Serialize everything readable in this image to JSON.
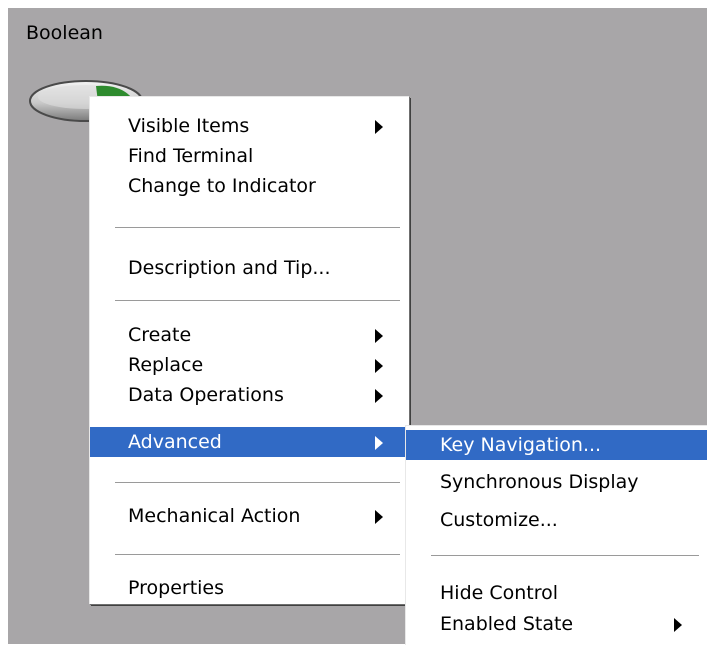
{
  "control": {
    "label": "Boolean",
    "switch_icon": "boolean-switch-icon"
  },
  "context_menu": {
    "items": [
      {
        "label": "Visible Items",
        "submenu": true
      },
      {
        "label": "Find Terminal",
        "submenu": false
      },
      {
        "label": "Change to Indicator",
        "submenu": false
      },
      {
        "label": "Description and Tip...",
        "submenu": false
      },
      {
        "label": "Create",
        "submenu": true
      },
      {
        "label": "Replace",
        "submenu": true
      },
      {
        "label": "Data Operations",
        "submenu": true
      },
      {
        "label": "Advanced",
        "submenu": true,
        "selected": true
      },
      {
        "label": "Mechanical Action",
        "submenu": true
      },
      {
        "label": "Properties",
        "submenu": false
      }
    ]
  },
  "advanced_submenu": {
    "items": [
      {
        "label": "Key Navigation...",
        "selected": true
      },
      {
        "label": "Synchronous Display"
      },
      {
        "label": "Customize..."
      },
      {
        "label": "Hide Control"
      },
      {
        "label": "Enabled State",
        "submenu": true
      }
    ]
  },
  "colors": {
    "panel_background": "#a8a6a8",
    "menu_background": "#ffffff",
    "selection": "#316ac5",
    "switch_green": "#2e8b2e"
  }
}
